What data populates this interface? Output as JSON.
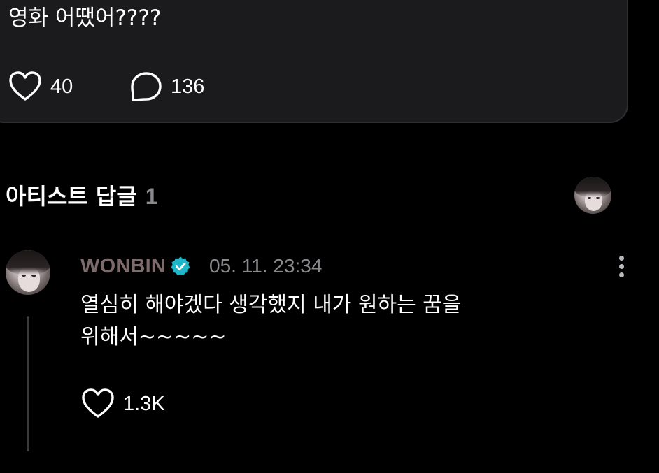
{
  "post": {
    "text": "영화 어땠어????",
    "like_count": "40",
    "comment_count": "136"
  },
  "artist_replies": {
    "title": "아티스트 답글",
    "count": "1"
  },
  "comment": {
    "author": "WONBIN",
    "timestamp": "05. 11. 23:34",
    "text_line1": "열심히 해야겠다 생각했지 내가 원하는 꿈을",
    "text_line2": "위해서~~~~~",
    "like_count": "1.3K"
  },
  "icons": {
    "like": "heart-outline-icon",
    "comment": "speech-bubble-icon",
    "verified": "verified-badge-icon",
    "more": "more-vertical-icon"
  },
  "colors": {
    "background": "#000000",
    "card": "#1b1b1d",
    "author_name": "#7d6b6b",
    "verified_badge": "#1fb6c9",
    "muted_text": "#8a8a8e"
  }
}
